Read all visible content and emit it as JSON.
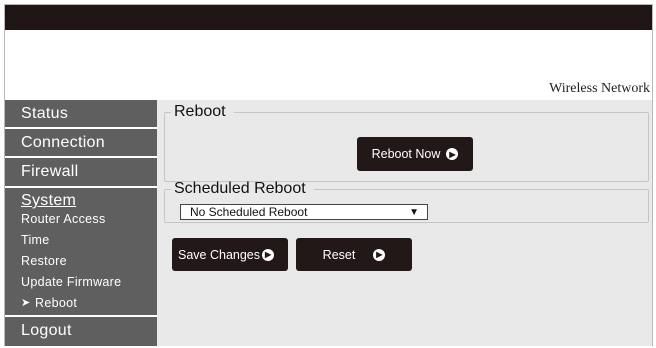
{
  "header": {
    "brand": "Wireless Network"
  },
  "sidebar": {
    "items": [
      {
        "label": "Status"
      },
      {
        "label": "Connection"
      },
      {
        "label": "Firewall"
      },
      {
        "label": "System",
        "subitems": [
          {
            "label": "Router Access"
          },
          {
            "label": "Time"
          },
          {
            "label": "Restore"
          },
          {
            "label": "Update Firmware"
          },
          {
            "label": "Reboot",
            "active": true
          }
        ]
      },
      {
        "label": "Logout"
      }
    ],
    "active_marker": "➤"
  },
  "main": {
    "reboot": {
      "legend": "Reboot",
      "button_label": "Reboot Now"
    },
    "scheduled": {
      "legend": "Scheduled Reboot",
      "selected": "No Scheduled Reboot"
    },
    "actions": {
      "save_label": "Save Changes",
      "reset_label": "Reset"
    }
  },
  "colors": {
    "topbar": "#1f1514",
    "nav": "#5f5f5f",
    "content_bg": "#e9e9e9",
    "button": "#221817"
  },
  "icons": {
    "button_arrow": "circle-arrow-right-icon",
    "dropdown": "caret-down-icon"
  }
}
